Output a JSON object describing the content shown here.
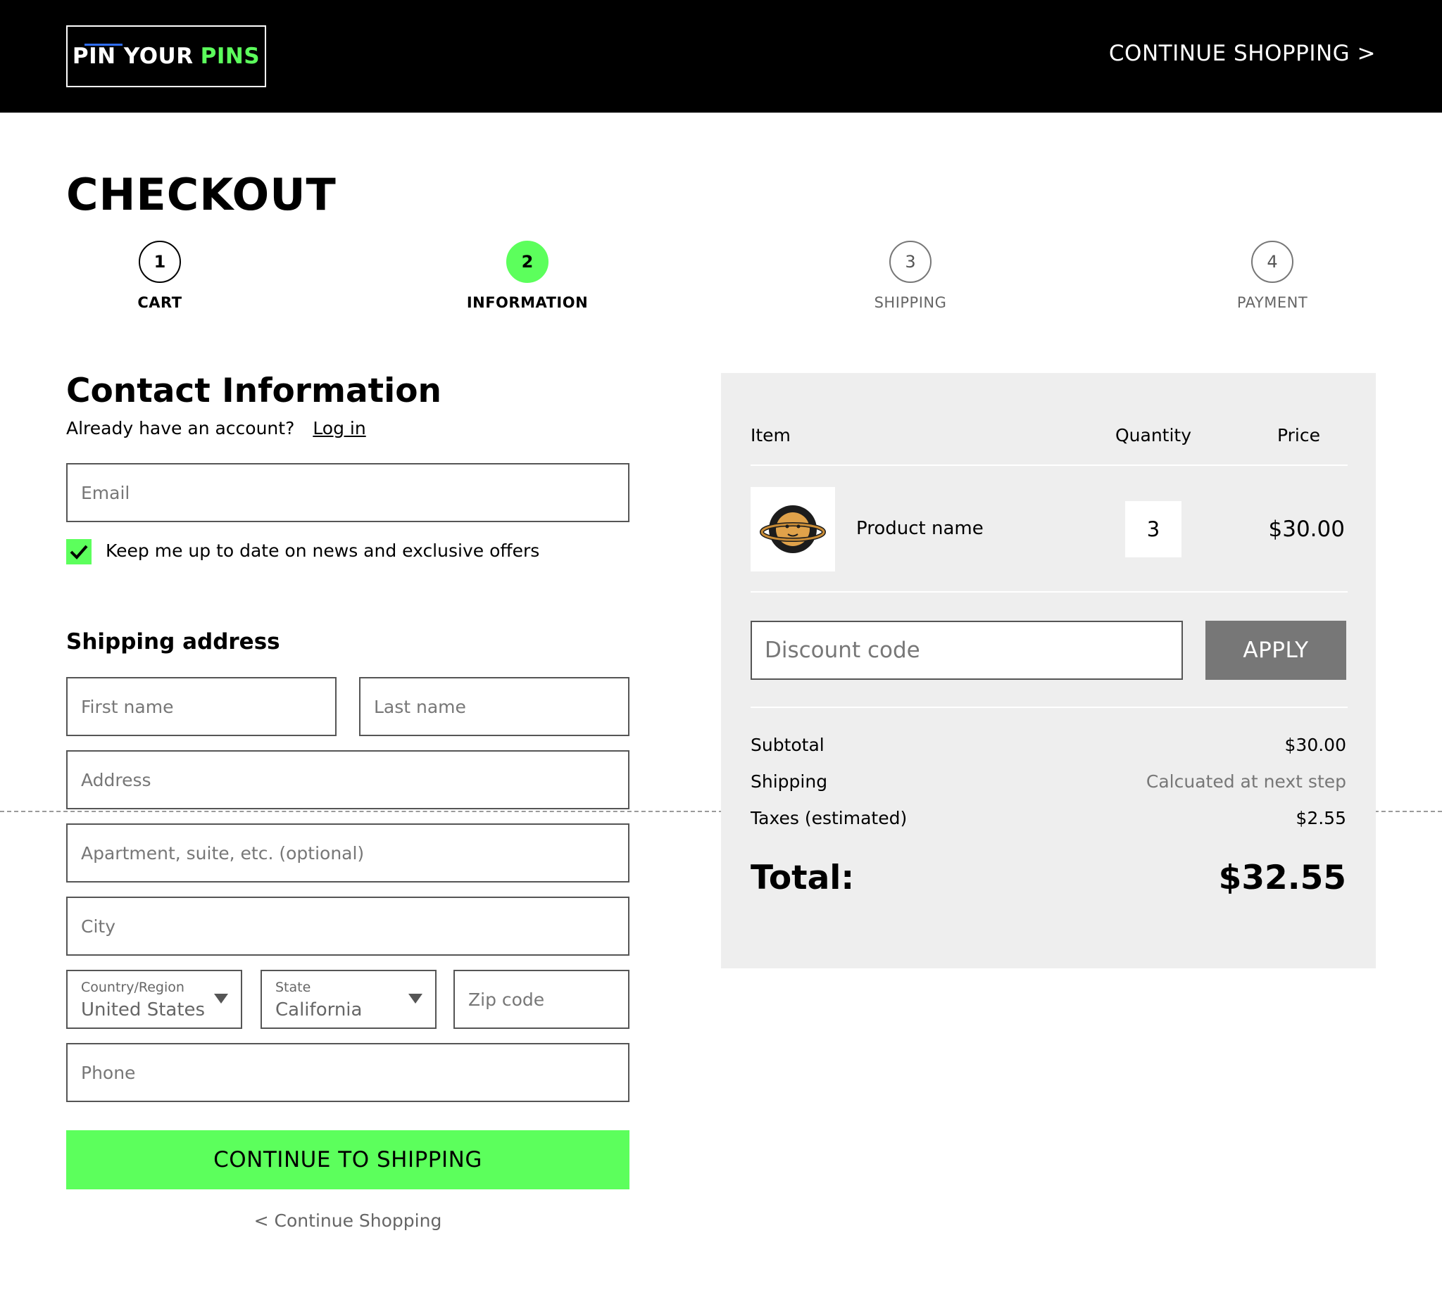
{
  "header": {
    "logo_part1": "PIN YOUR",
    "logo_part2": "PINS",
    "continue_shopping": "CONTINUE SHOPPING >"
  },
  "page": {
    "title": "CHECKOUT"
  },
  "steps": [
    {
      "number": "1",
      "label": "CART",
      "state": "complete"
    },
    {
      "number": "2",
      "label": "INFORMATION",
      "state": "active"
    },
    {
      "number": "3",
      "label": "SHIPPING",
      "state": "upcoming"
    },
    {
      "number": "4",
      "label": "PAYMENT",
      "state": "upcoming"
    }
  ],
  "contact": {
    "title": "Contact Information",
    "account_prompt": "Already have an account?",
    "login_label": "Log in",
    "email_placeholder": "Email",
    "newsletter_label": "Keep me up to date on news and exclusive offers",
    "newsletter_checked": true
  },
  "shipping_address": {
    "title": "Shipping address",
    "first_name_placeholder": "First name",
    "last_name_placeholder": "Last name",
    "address_placeholder": "Address",
    "apartment_placeholder": "Apartment, suite, etc. (optional)",
    "city_placeholder": "City",
    "country_label": "Country/Region",
    "country_value": "United States",
    "state_label": "State",
    "state_value": "California",
    "zip_placeholder": "Zip code",
    "phone_placeholder": "Phone"
  },
  "actions": {
    "continue_to_shipping": "CONTINUE TO SHIPPING",
    "continue_shopping": "< Continue Shopping"
  },
  "summary": {
    "col_item": "Item",
    "col_quantity": "Quantity",
    "col_price": "Price",
    "item": {
      "name": "Product name",
      "image_icon": "pin-product-image",
      "quantity": "3",
      "price": "$30.00"
    },
    "discount_placeholder": "Discount code",
    "apply_label": "APPLY",
    "subtotal_label": "Subtotal",
    "subtotal_value": "$30.00",
    "shipping_label": "Shipping",
    "shipping_value": "Calcuated at next step",
    "taxes_label": "Taxes (estimated)",
    "taxes_value": "$2.55",
    "total_label": "Total:",
    "total_value": "$32.55"
  },
  "colors": {
    "accent_green": "#5cff5c",
    "header_bg": "#000000",
    "summary_bg": "#eeeeee",
    "apply_button": "#777777"
  }
}
